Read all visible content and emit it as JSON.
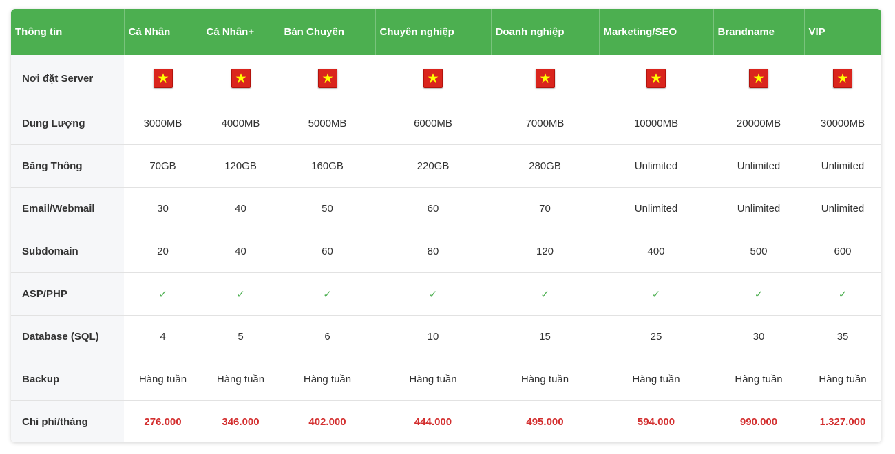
{
  "columns": [
    "Thông tin",
    "Cá Nhân",
    "Cá Nhân+",
    "Bán Chuyên",
    "Chuyên nghiệp",
    "Doanh nghiệp",
    "Marketing/SEO",
    "Brandname",
    "VIP"
  ],
  "row_labels": {
    "location": "Nơi đặt Server",
    "storage": "Dung Lượng",
    "bandwidth": "Băng Thông",
    "email": "Email/Webmail",
    "subdomain": "Subdomain",
    "asp_php": "ASP/PHP",
    "database": "Database (SQL)",
    "backup": "Backup",
    "price": "Chi phí/tháng"
  },
  "location_icon": "vietnam-flag-icon",
  "check_icon": "check-icon",
  "check_glyph": "✓",
  "storage": [
    "3000MB",
    "4000MB",
    "5000MB",
    "6000MB",
    "7000MB",
    "10000MB",
    "20000MB",
    "30000MB"
  ],
  "bandwidth": [
    "70GB",
    "120GB",
    "160GB",
    "220GB",
    "280GB",
    "Unlimited",
    "Unlimited",
    "Unlimited"
  ],
  "email": [
    "30",
    "40",
    "50",
    "60",
    "70",
    "Unlimited",
    "Unlimited",
    "Unlimited"
  ],
  "subdomain": [
    "20",
    "40",
    "60",
    "80",
    "120",
    "400",
    "500",
    "600"
  ],
  "database": [
    "4",
    "5",
    "6",
    "10",
    "15",
    "25",
    "30",
    "35"
  ],
  "backup": [
    "Hàng tuần",
    "Hàng tuần",
    "Hàng tuần",
    "Hàng tuần",
    "Hàng tuần",
    "Hàng tuần",
    "Hàng tuần",
    "Hàng tuần"
  ],
  "price": [
    "276.000",
    "346.000",
    "402.000",
    "444.000",
    "495.000",
    "594.000",
    "990.000",
    "1.327.000"
  ],
  "colors": {
    "header_bg": "#4caf50",
    "price_text": "#d32f2f",
    "check": "#4caf50",
    "flag_red": "#da251d",
    "flag_star": "#ffff00",
    "label_bg": "#f6f7f9"
  }
}
